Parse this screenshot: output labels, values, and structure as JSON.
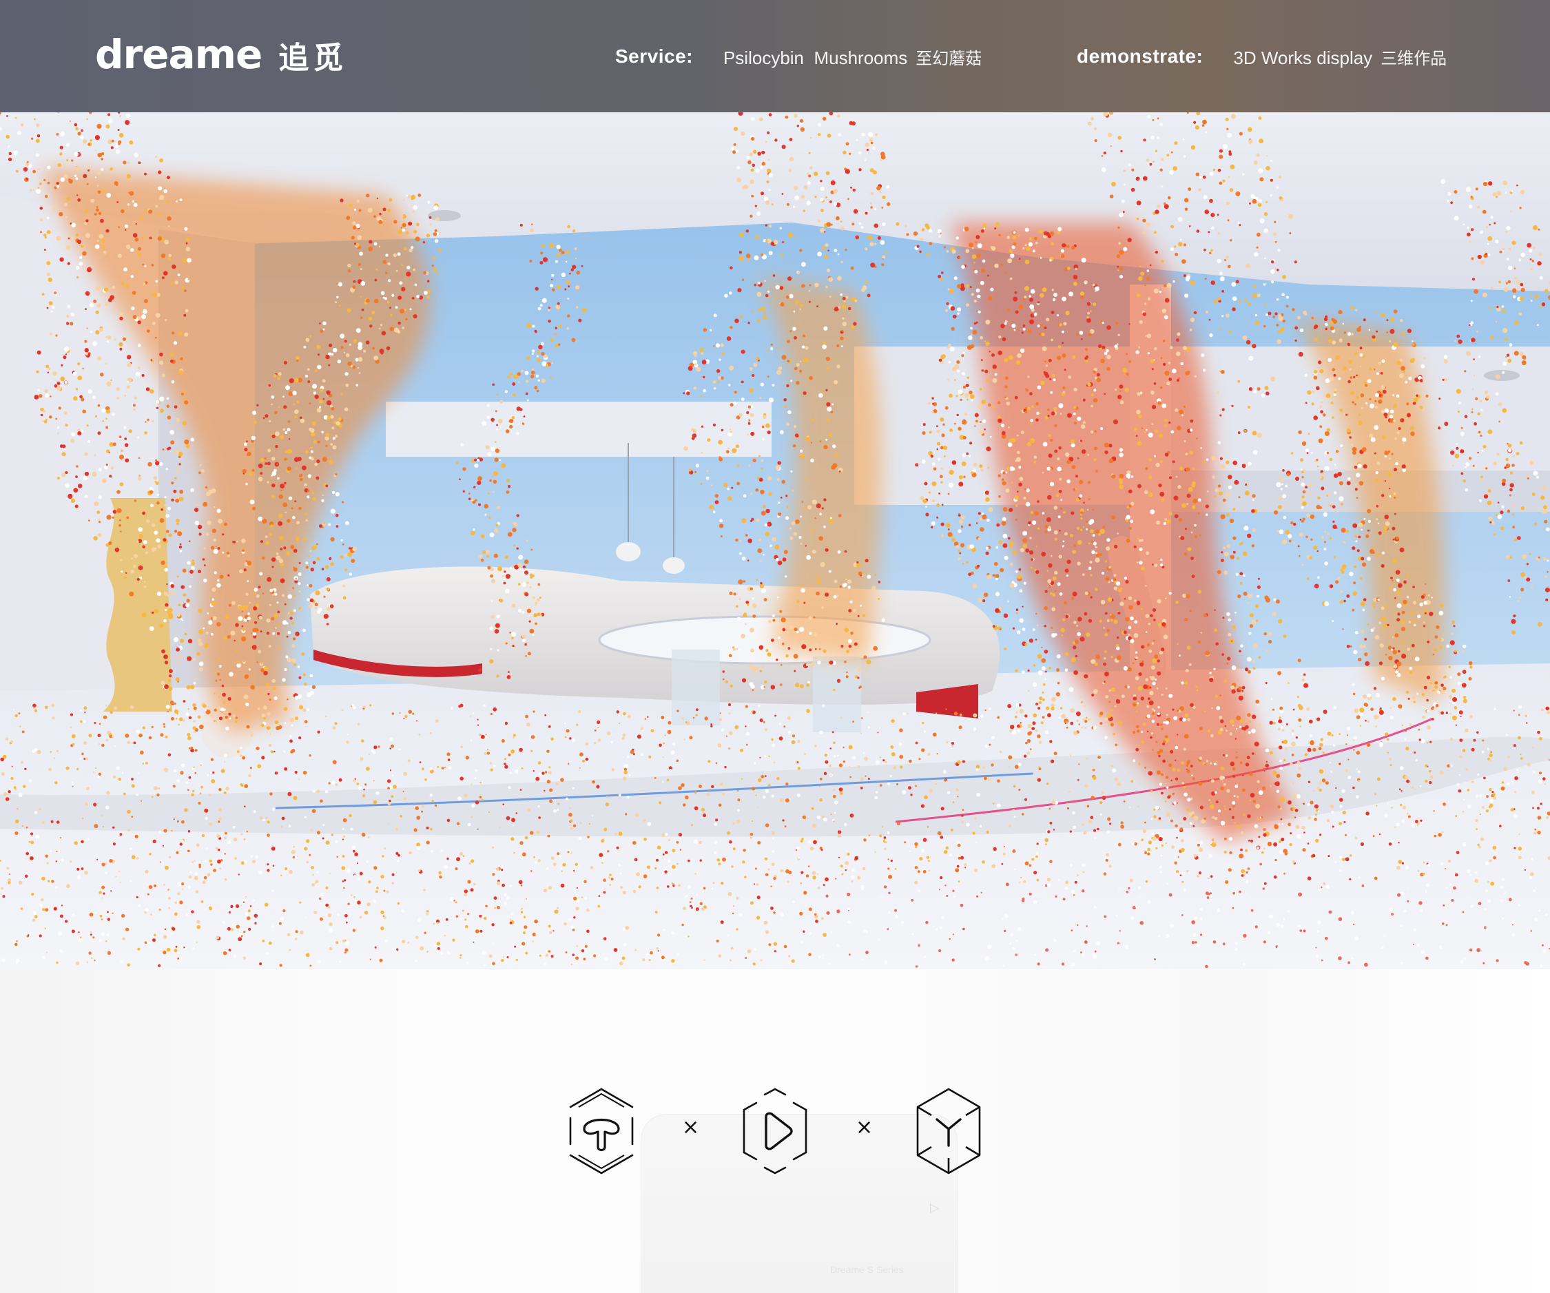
{
  "brand": {
    "logo_word": "dreame",
    "logo_cn": "追觅"
  },
  "nav": {
    "service": {
      "label": "Service:",
      "link_en": "Psilocybin  Mushrooms",
      "link_cn": "至幻蘑菇"
    },
    "demonstrate": {
      "label": "demonstrate:",
      "link_en": "3D Works display",
      "link_cn": "三维作品"
    }
  },
  "hero": {
    "scene": "particle-interior-render"
  },
  "lower": {
    "device_caption": "Dreame S Series",
    "icons": [
      {
        "name": "mushroom-icon"
      },
      {
        "name": "play-icon"
      },
      {
        "name": "cube-y-icon"
      }
    ],
    "separator": "×"
  },
  "colors": {
    "header_bg": "#63636a",
    "particle_orange": "#f2792a",
    "particle_red": "#e3362a",
    "particle_yellow": "#f6b840",
    "sky": "#a9cdee",
    "icon_stroke": "#111111"
  }
}
